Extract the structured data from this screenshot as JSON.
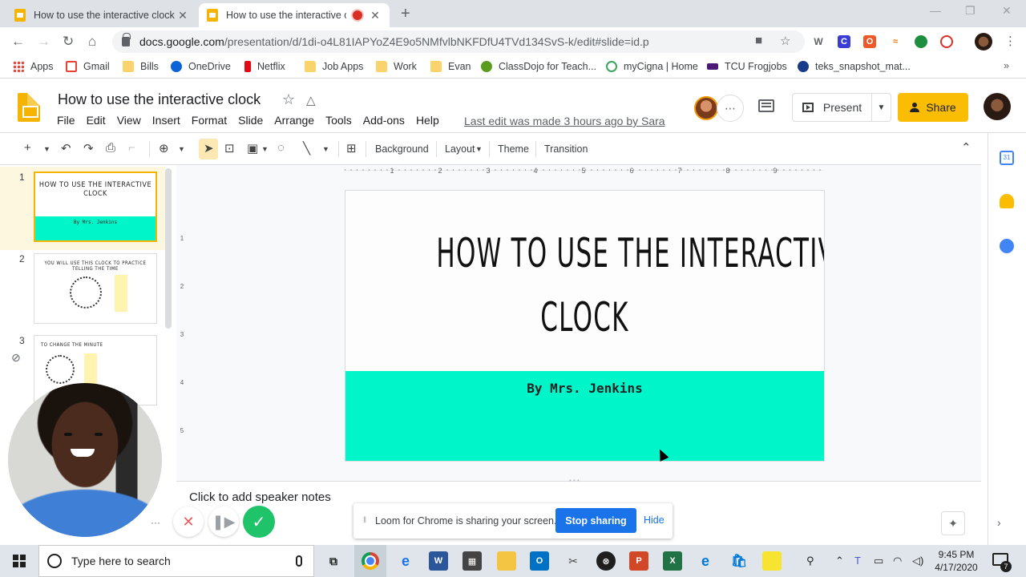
{
  "browser": {
    "tabs": [
      {
        "title": "How to use the interactive clock"
      },
      {
        "title": "How to use the interactive clock"
      }
    ],
    "url_main": "docs.google.com",
    "url_rest": "/presentation/d/1di-o4L81IAPYoZ4E9o5NMfvlbNKFDfU4TVd134SvS-k/edit#slide=id.p",
    "bookmarks": [
      "Apps",
      "Gmail",
      "Bills",
      "OneDrive",
      "Netflix",
      "Job Apps",
      "Work",
      "Evan",
      "ClassDojo for Teach...",
      "myCigna | Home",
      "TCU Frogjobs",
      "teks_snapshot_mat..."
    ]
  },
  "slides_app": {
    "doc_title": "How to use the interactive clock",
    "menu": [
      "File",
      "Edit",
      "View",
      "Insert",
      "Format",
      "Slide",
      "Arrange",
      "Tools",
      "Add-ons",
      "Help"
    ],
    "last_edit": "Last edit was made 3 hours ago by Sara",
    "present_label": "Present",
    "share_label": "Share",
    "toolbar": {
      "background": "Background",
      "layout": "Layout",
      "theme": "Theme",
      "transition": "Transition"
    },
    "ruler_top": [
      "1",
      "2",
      "3",
      "4",
      "5",
      "6",
      "7",
      "8",
      "9"
    ],
    "ruler_left": [
      "1",
      "2",
      "3",
      "4",
      "5"
    ]
  },
  "filmstrip": {
    "slides": [
      {
        "num": "1",
        "title": "How to use the interactive clock",
        "sub": "By Mrs. Jenkins"
      },
      {
        "num": "2",
        "title": "You will use this clock to practice telling the time"
      },
      {
        "num": "3",
        "title": "To change the minute"
      }
    ]
  },
  "slide": {
    "title_line1": "How to use the interactive",
    "title_line2": "clock",
    "subtitle": "By Mrs. Jenkins",
    "band_color": "#00f5c8"
  },
  "notes": {
    "placeholder": "Click to add speaker notes"
  },
  "loom": {
    "message": "Loom for Chrome is sharing your screen.",
    "stop_label": "Stop sharing",
    "hide_label": "Hide"
  },
  "taskbar": {
    "search_placeholder": "Type here to search",
    "time": "9:45 PM",
    "date": "4/17/2020",
    "notification_count": "7"
  },
  "colors": {
    "accent_yellow": "#fbbc04",
    "loom_blue": "#1a73e8",
    "slide_band": "#00f5c8"
  }
}
